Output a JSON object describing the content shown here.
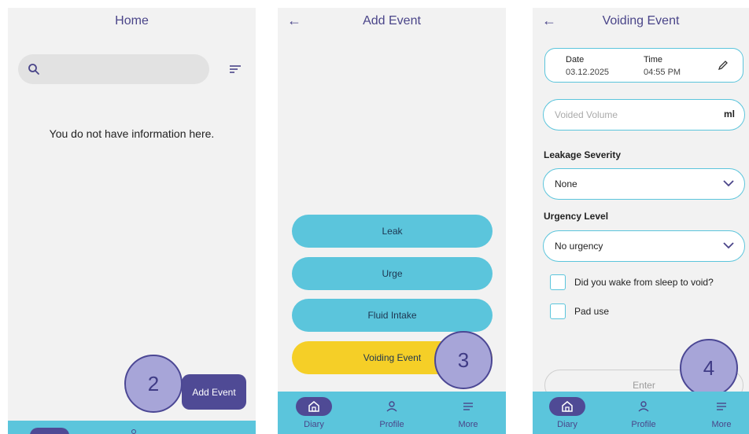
{
  "screen_home": {
    "title": "Home",
    "empty_message": "You do not have information here.",
    "add_event_label": "Add Event",
    "callout": "2"
  },
  "screen_add_event": {
    "title": "Add Event",
    "buttons": [
      "Leak",
      "Urge",
      "Fluid Intake",
      "Voiding Event"
    ],
    "callout": "3"
  },
  "screen_voiding": {
    "title": "Voiding Event",
    "date_label": "Date",
    "date_value": "03.12.2025",
    "time_label": "Time",
    "time_value": "04:55 PM",
    "volume_placeholder": "Voided Volume",
    "volume_unit": "ml",
    "leakage_label": "Leakage Severity",
    "leakage_value": "None",
    "urgency_label": "Urgency Level",
    "urgency_value": "No urgency",
    "checkbox_sleep": "Did you wake from sleep to void?",
    "checkbox_pad": "Pad use",
    "enter_label": "Enter",
    "callout": "4"
  },
  "nav": {
    "diary": "Diary",
    "profile": "Profile",
    "more": "More"
  },
  "colors": {
    "primary": "#4f4a95",
    "accent": "#5bc5dc",
    "highlight": "#f5cf27",
    "callout": "#a7a5d8"
  },
  "icons": [
    "search-icon",
    "filter-icon",
    "back-arrow-icon",
    "edit-icon",
    "chevron-down-icon",
    "home-icon",
    "profile-icon",
    "menu-icon"
  ]
}
